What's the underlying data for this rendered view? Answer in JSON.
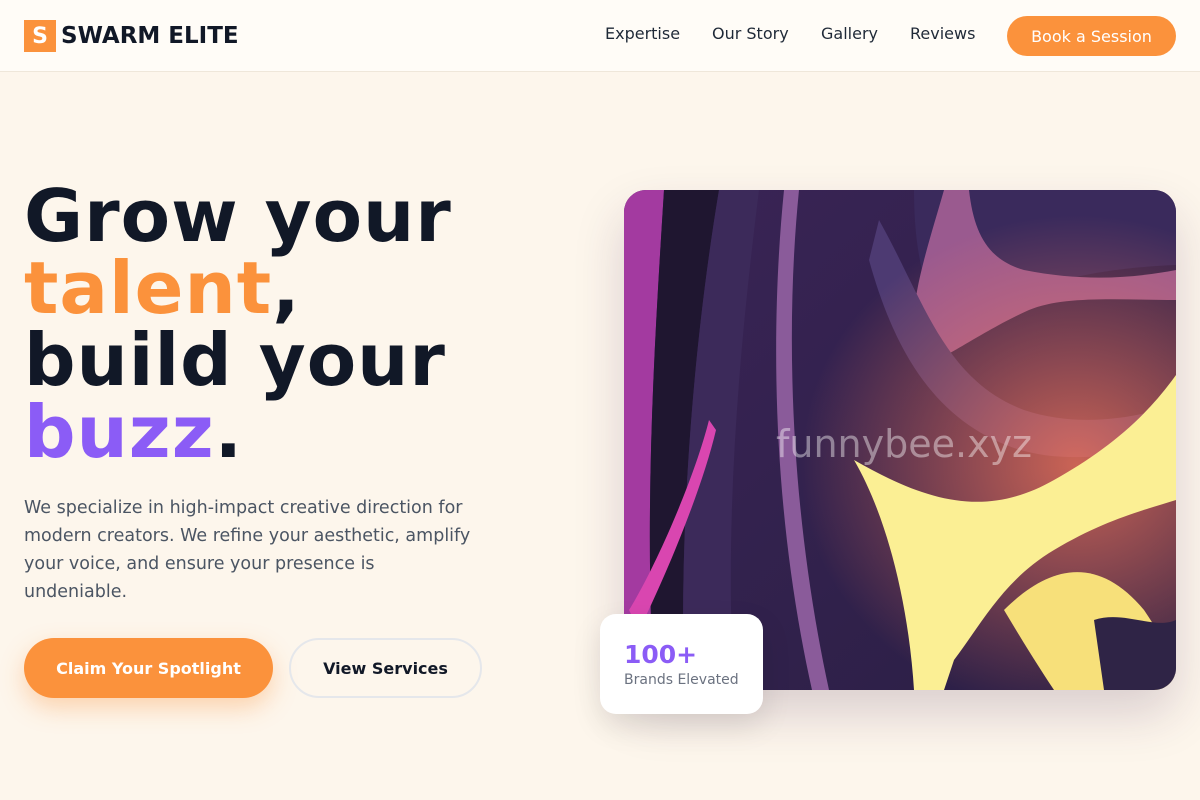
{
  "brand": {
    "logo_letter": "S",
    "name": "SWARM ELITE",
    "accent_color": "#fb923c",
    "secondary_color": "#8b5cf6"
  },
  "nav": {
    "items": [
      {
        "label": "Expertise"
      },
      {
        "label": "Our Story"
      },
      {
        "label": "Gallery"
      },
      {
        "label": "Reviews"
      }
    ],
    "cta_label": "Book a Session"
  },
  "hero": {
    "headline": {
      "line1": "Grow your",
      "highlight1": "talent",
      "punct1": ",",
      "line3": "build your",
      "highlight2": "buzz",
      "punct2": "."
    },
    "description": "We specialize in high-impact creative direction for modern creators. We refine your aesthetic, amplify your voice, and ensure your presence is undeniable.",
    "primary_cta": "Claim Your Spotlight",
    "secondary_cta": "View Services",
    "image_watermark": "funnybee.xyz",
    "stat": {
      "value": "100+",
      "label": "Brands Elevated"
    }
  }
}
